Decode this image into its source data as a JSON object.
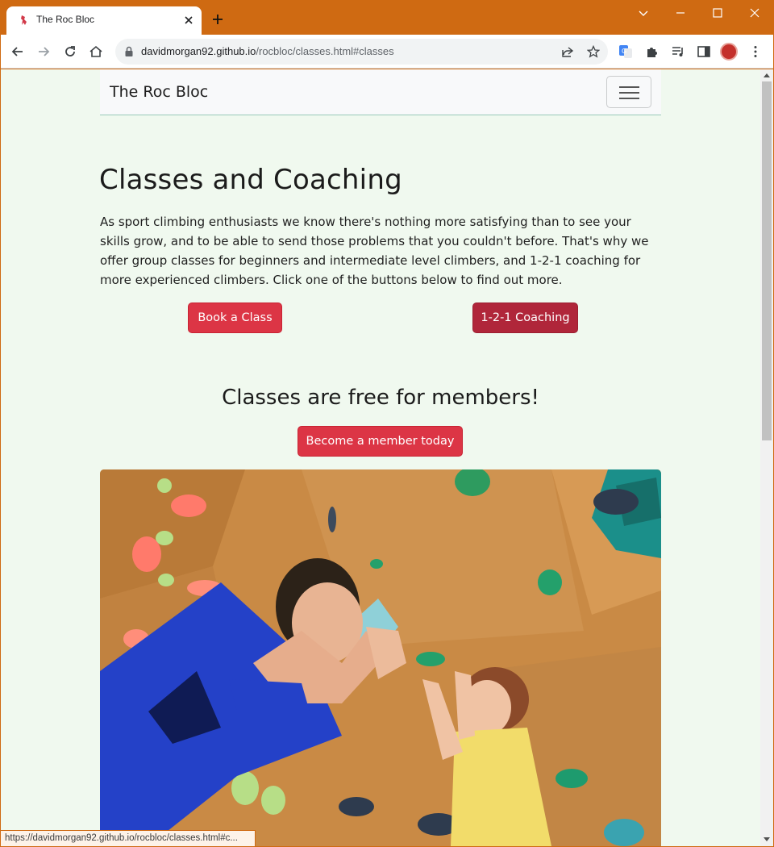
{
  "browser": {
    "tab_title": "The Roc Bloc",
    "url_host": "davidmorgan92.github.io",
    "url_path": "/rocbloc/classes.html#classes",
    "status_url": "https://davidmorgan92.github.io/rocbloc/classes.html#c...",
    "accent_color": "#cf6a12"
  },
  "navbar": {
    "brand": "The Roc Bloc"
  },
  "main": {
    "heading": "Classes and Coaching",
    "intro": "As sport climbing enthusiasts we know there's nothing more satisfying than to see your skills grow, and to be able to send those problems that you couldn't before. That's why we offer group classes for beginners and intermediate level climbers, and 1-2-1 coaching for more experienced climbers. Click one of the buttons below to find out more.",
    "book_button": "Book a Class",
    "coaching_button": "1-2-1 Coaching",
    "members_heading": "Classes are free for members!",
    "member_button": "Become a member today"
  },
  "colors": {
    "page_bg": "#f0f9ef",
    "button_red": "#dc3545",
    "button_dark_red": "#b0263a"
  }
}
